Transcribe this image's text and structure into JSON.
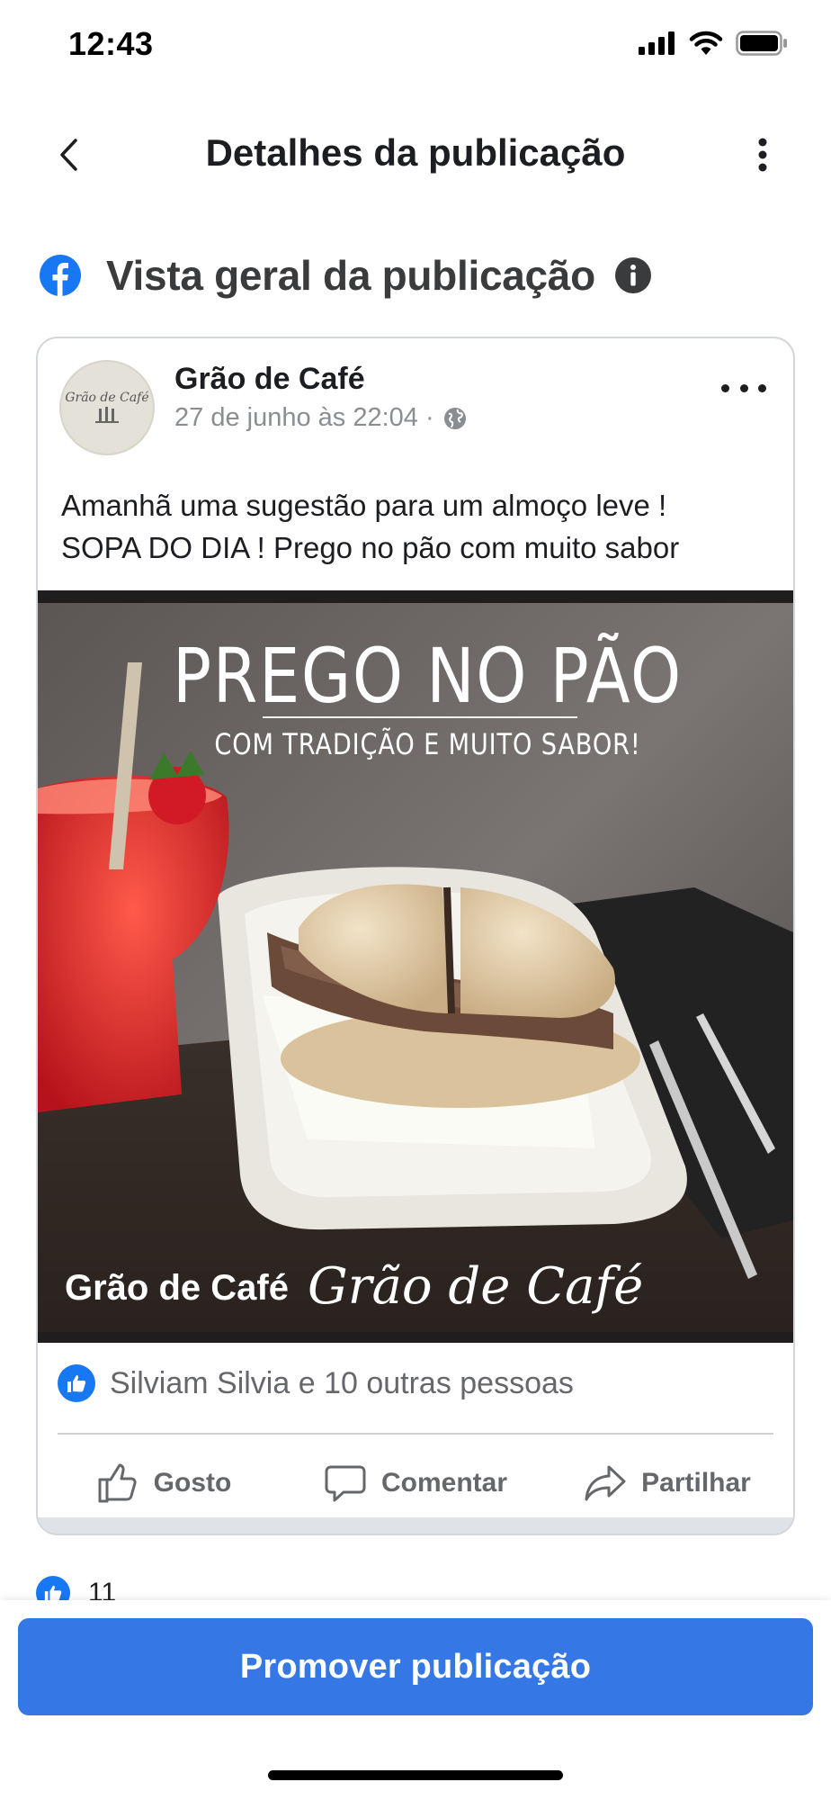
{
  "status_bar": {
    "time": "12:43",
    "icons": [
      "signal-icon",
      "wifi-icon",
      "battery-icon"
    ]
  },
  "header": {
    "title": "Detalhes da publicação",
    "back_icon": "chevron-left-icon",
    "more_icon": "vertical-dots-icon"
  },
  "section": {
    "title": "Vista geral da publicação",
    "icon": "facebook-icon",
    "info_icon": "info-icon"
  },
  "post": {
    "page_name": "Grão de Café",
    "avatar_text": "Grão de Café",
    "timestamp": "27 de junho às 22:04 ·",
    "privacy_icon": "globe-icon",
    "text_line1": "Amanhã uma sugestão para um almoço leve !",
    "text_line2": "SOPA DO DIA ! Prego no pão com muito sabor",
    "image": {
      "headline": "PREGO NO PÃO",
      "subline": "COM TRADIÇÃO E MUITO SABOR!",
      "brand_bold": "Grão de Café",
      "brand_script": "Grão de Café"
    },
    "reactions_text": "Silviam Silvia e 10 outras pessoas",
    "actions": [
      {
        "label": "Gosto",
        "icon": "thumbs-up-icon"
      },
      {
        "label": "Comentar",
        "icon": "comment-icon"
      },
      {
        "label": "Partilhar",
        "icon": "share-icon"
      }
    ]
  },
  "likes_summary": {
    "count": "11"
  },
  "promote_button": {
    "label": "Promover publicação"
  },
  "colors": {
    "brand_blue": "#1877f2",
    "button_blue": "#3578e5",
    "text_dark": "#1c1e21",
    "text_gray": "#65676b"
  }
}
